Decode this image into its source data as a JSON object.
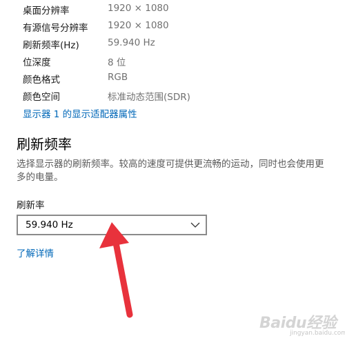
{
  "display_info": {
    "rows": [
      {
        "label": "桌面分辨率",
        "value": "1920 × 1080"
      },
      {
        "label": "有源信号分辨率",
        "value": "1920 × 1080"
      },
      {
        "label": "刷新频率(Hz)",
        "value": "59.940 Hz"
      },
      {
        "label": "位深度",
        "value": "8 位"
      },
      {
        "label": "颜色格式",
        "value": "RGB"
      },
      {
        "label": "颜色空间",
        "value": "标准动态范围(SDR)"
      }
    ],
    "adapter_link": "显示器 1 的显示适配器属性"
  },
  "refresh_section": {
    "title": "刷新频率",
    "description": "选择显示器的刷新频率。较高的速度可提供更流畅的运动，同时也会使用更多的电量。",
    "rate_label": "刷新率",
    "selected_rate": "59.940 Hz",
    "learn_more": "了解详情"
  },
  "annotation": {
    "arrow_color": "#e8323c"
  },
  "watermark": {
    "text": "Baidu经验",
    "sub": "jingyan.baidu.com"
  },
  "colors": {
    "link": "#0067b8",
    "secondary_text": "#707070"
  }
}
